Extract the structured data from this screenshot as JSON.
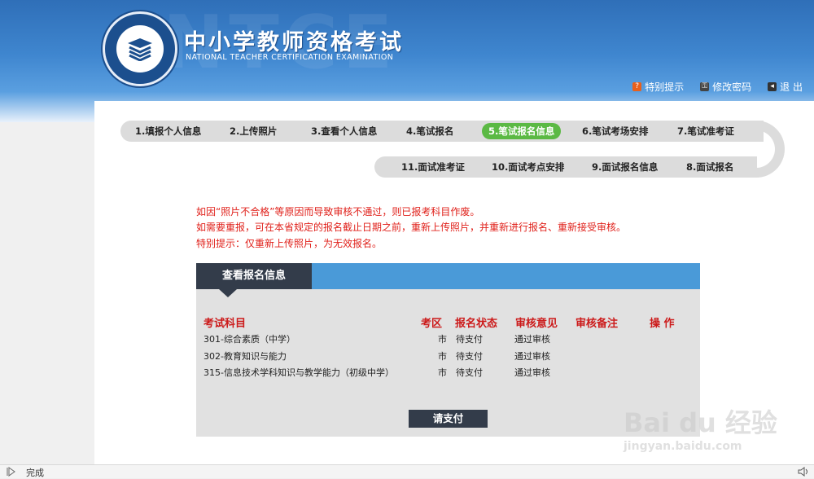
{
  "header": {
    "title": "中小学教师资格考试",
    "subtitle": "NATIONAL TEACHER CERTIFICATION EXAMINATION",
    "bg_text": "NTCE",
    "links": [
      {
        "label": "特别提示",
        "icon": "help-icon",
        "color": "#e8601c"
      },
      {
        "label": "修改密码",
        "icon": "key-icon",
        "color": "#444444"
      },
      {
        "label": "退 出",
        "icon": "logout-icon",
        "color": "#333333"
      }
    ]
  },
  "steps_row1": [
    "1.填报个人信息",
    "2.上传照片",
    "3.查看个人信息",
    "4.笔试报名",
    "5.笔试报名信息",
    "6.笔试考场安排",
    "7.笔试准考证"
  ],
  "steps_row2": [
    "11.面试准考证",
    "10.面试考点安排",
    "9.面试报名信息",
    "8.面试报名"
  ],
  "active_step": "5.笔试报名信息",
  "notices": [
    "如因“照片不合格”等原因而导致审核不通过，则已报考科目作废。",
    "如需要重报，可在本省规定的报名截止日期之前，重新上传照片，并重新进行报名、重新接受审核。",
    "特别提示：仅重新上传照片，为无效报名。"
  ],
  "panel": {
    "title": "查看报名信息",
    "columns": [
      "考试科目",
      "考区",
      "报名状态",
      "审核意见",
      "审核备注",
      "操 作"
    ],
    "rows": [
      {
        "subject": "301-综合素质（中学）",
        "area": "市",
        "status": "待支付",
        "review": "通过审核",
        "note": "",
        "action": ""
      },
      {
        "subject": "302-教育知识与能力",
        "area": "市",
        "status": "待支付",
        "review": "通过审核",
        "note": "",
        "action": ""
      },
      {
        "subject": "315-信息技术学科知识与教学能力（初级中学）",
        "area": "市",
        "status": "待支付",
        "review": "通过审核",
        "note": "",
        "action": ""
      }
    ],
    "pay_button": "请支付"
  },
  "statusbar": {
    "text": "完成"
  },
  "watermark": {
    "brand": "Bai du 经验",
    "url": "jingyan.baidu.com"
  },
  "colors": {
    "header_blue": "#3f86cf",
    "active_step": "#5bb944",
    "notice_red": "#e0201a",
    "panel_bar": "#4a9ad8",
    "panel_dark": "#333c4a"
  }
}
